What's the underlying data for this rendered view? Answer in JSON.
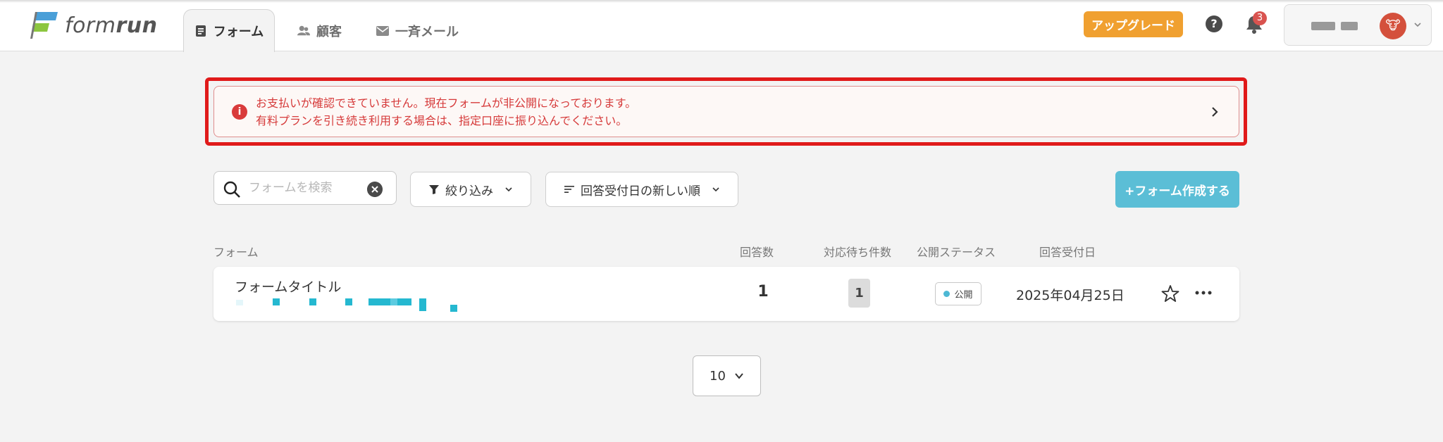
{
  "app": {
    "logo_text_light": "form",
    "logo_text_bold": "run"
  },
  "nav": {
    "tabs": [
      {
        "label": "フォーム",
        "icon": "document-icon"
      },
      {
        "label": "顧客",
        "icon": "users-icon"
      },
      {
        "label": "一斉メール",
        "icon": "mail-icon"
      }
    ]
  },
  "header": {
    "upgrade_label": "アップグレード",
    "help_glyph": "?",
    "notification_count": "3",
    "avatar_glyph": "🐮"
  },
  "alert": {
    "line1": "お支払いが確認できていません。現在フォームが非公開になっております。",
    "line2": "有料プランを引き続き利用する場合は、指定口座に振り込んでください。",
    "icon_glyph": "i"
  },
  "toolbar": {
    "search_placeholder": "フォームを検索",
    "filter_label": "絞り込み",
    "sort_label": "回答受付日の新しい順",
    "create_label": "+フォーム作成する"
  },
  "table": {
    "headers": {
      "form": "フォーム",
      "responses": "回答数",
      "pending": "対応待ち件数",
      "status": "公開ステータス",
      "date": "回答受付日"
    },
    "rows": [
      {
        "title": "フォームタイトル",
        "responses": "1",
        "pending": "1",
        "status": "公開",
        "date": "2025年04月25日"
      }
    ]
  },
  "pagination": {
    "per_page": "10"
  },
  "colors": {
    "upgrade": "#f0a030",
    "alert_text": "#d63a3a",
    "alert_outline": "#e01a1a",
    "create_button": "#5bbed6",
    "badge": "#d9534f",
    "status_dot": "#4db8d4"
  }
}
